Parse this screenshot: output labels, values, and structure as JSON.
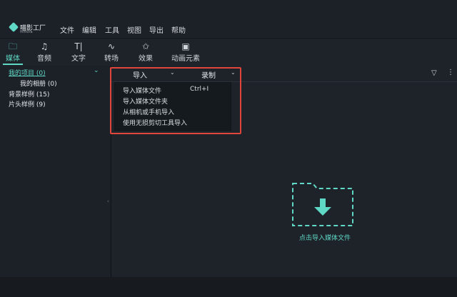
{
  "app": {
    "logo_text": "喵影工厂",
    "logo_sub": "filmora"
  },
  "menu": [
    "文件",
    "编辑",
    "工具",
    "视图",
    "导出",
    "帮助"
  ],
  "toolbar": [
    {
      "label": "媒体",
      "icon": "folder-icon",
      "glyph": "🗀"
    },
    {
      "label": "音频",
      "icon": "music-note-icon",
      "glyph": "♫"
    },
    {
      "label": "文字",
      "icon": "text-icon",
      "glyph": "T|"
    },
    {
      "label": "转场",
      "icon": "transition-icon",
      "glyph": "∿"
    },
    {
      "label": "效果",
      "icon": "effects-icon",
      "glyph": "✩"
    },
    {
      "label": "动画元素",
      "icon": "image-icon",
      "glyph": "▣"
    }
  ],
  "sidebar": {
    "my_project": "我的项目 (0)",
    "my_album": "我的相册 (0)",
    "bg_samples": "背景样例 (15)",
    "intro_samples": "片头样例 (9)"
  },
  "main": {
    "import_label": "导入",
    "record_label": "录制",
    "dropdown": [
      {
        "label": "导入媒体文件",
        "shortcut": "Ctrl+I"
      },
      {
        "label": "导入媒体文件夹",
        "shortcut": ""
      },
      {
        "label": "从相机或手机导入",
        "shortcut": ""
      },
      {
        "label": "使用无损剪切工具导入",
        "shortcut": ""
      }
    ],
    "drop_label": "点击导入媒体文件"
  },
  "colors": {
    "accent": "#5fd8c6",
    "highlight": "#e0453b",
    "bg": "#1e2329"
  }
}
